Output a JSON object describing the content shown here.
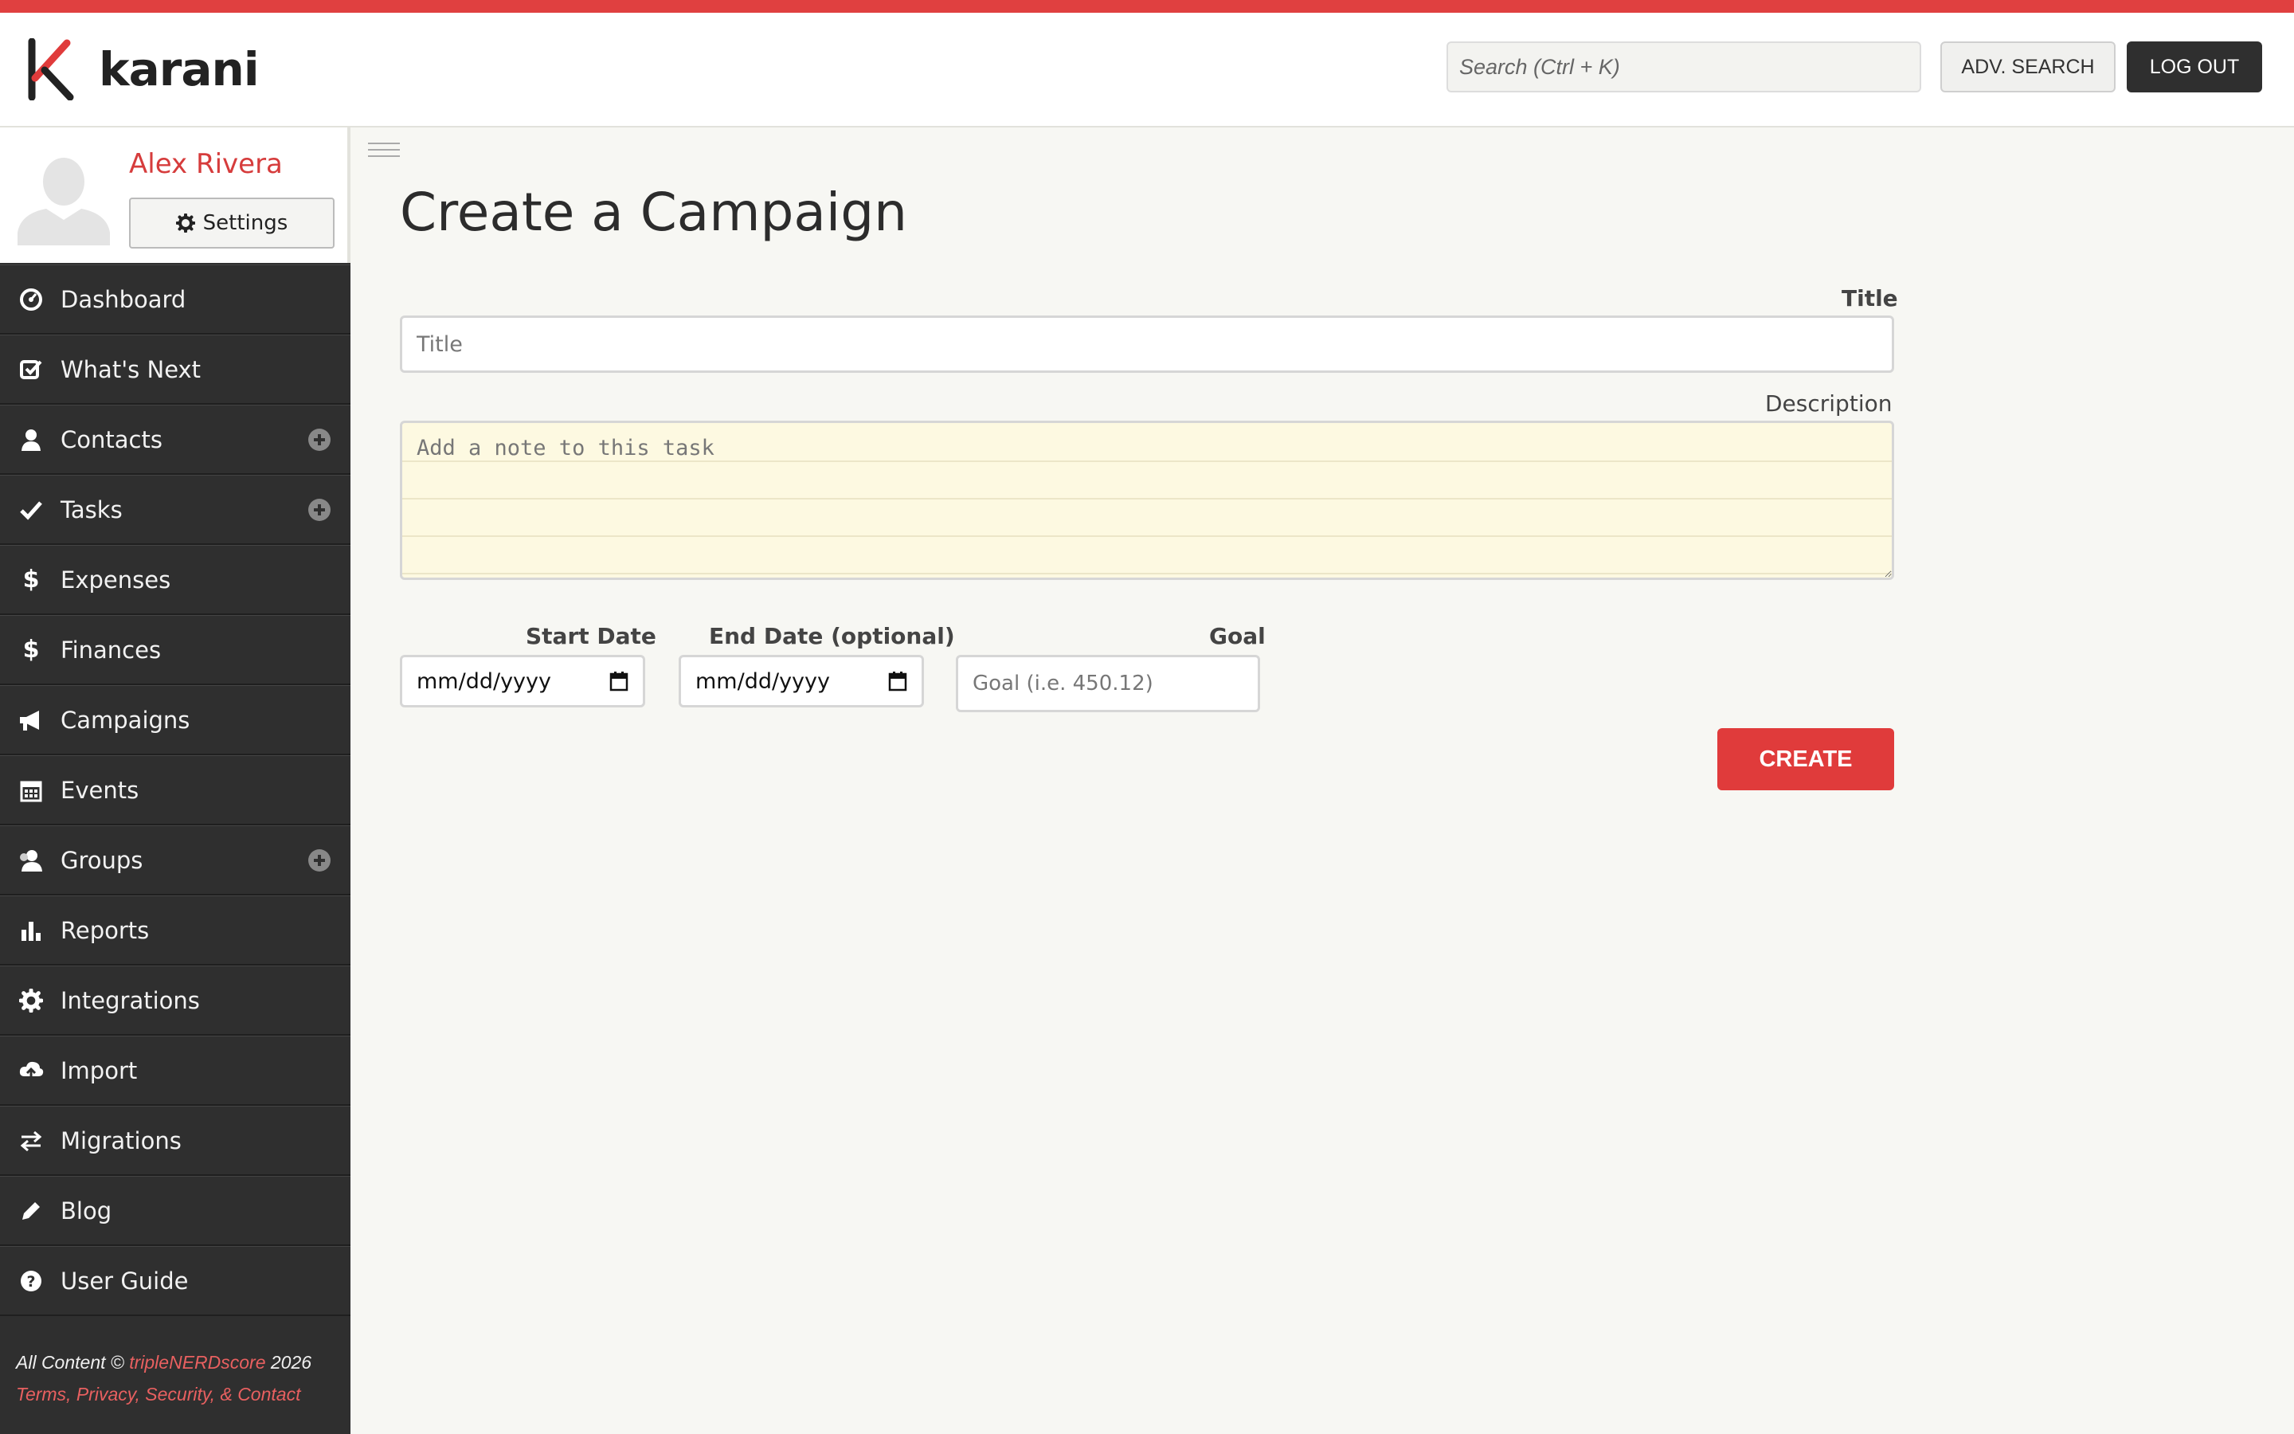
{
  "app": {
    "brand": "karani",
    "accent_color": "#e03b3b"
  },
  "header": {
    "search_placeholder": "Search (Ctrl + K)",
    "adv_search_label": "ADV. SEARCH",
    "logout_label": "LOG OUT"
  },
  "profile": {
    "name": "Alex Rivera",
    "settings_label": "Settings"
  },
  "sidebar": {
    "items": [
      {
        "label": "Dashboard",
        "icon": "dashboard-icon",
        "has_add": false
      },
      {
        "label": "What's Next",
        "icon": "checkbox-icon",
        "has_add": false
      },
      {
        "label": "Contacts",
        "icon": "person-icon",
        "has_add": true
      },
      {
        "label": "Tasks",
        "icon": "check-icon",
        "has_add": true
      },
      {
        "label": "Expenses",
        "icon": "dollar-icon",
        "has_add": false
      },
      {
        "label": "Finances",
        "icon": "dollar-icon",
        "has_add": false
      },
      {
        "label": "Campaigns",
        "icon": "megaphone-icon",
        "has_add": false
      },
      {
        "label": "Events",
        "icon": "calendar-icon",
        "has_add": false
      },
      {
        "label": "Groups",
        "icon": "group-icon",
        "has_add": true
      },
      {
        "label": "Reports",
        "icon": "bar-chart-icon",
        "has_add": false
      },
      {
        "label": "Integrations",
        "icon": "gear-icon",
        "has_add": false
      },
      {
        "label": "Import",
        "icon": "cloud-upload-icon",
        "has_add": false
      },
      {
        "label": "Migrations",
        "icon": "transfer-icon",
        "has_add": false
      },
      {
        "label": "Blog",
        "icon": "pencil-icon",
        "has_add": false
      },
      {
        "label": "User Guide",
        "icon": "question-icon",
        "has_add": false
      }
    ]
  },
  "footer": {
    "prefix": "All Content © ",
    "company": "tripleNERDscore",
    "year": " 2026",
    "links": "Terms, Privacy, Security, & Contact"
  },
  "form": {
    "heading": "Create a Campaign",
    "title_label": "Title",
    "title_placeholder": "Title",
    "description_label": "Description",
    "description_placeholder": "Add a note to this task",
    "start_date_label": "Start Date",
    "start_date_value": "mm/dd/yyyy",
    "end_date_label": "End Date (optional)",
    "end_date_value": "mm/dd/yyyy",
    "goal_label": "Goal",
    "goal_placeholder": "Goal (i.e. 450.12)",
    "create_label": "CREATE"
  }
}
